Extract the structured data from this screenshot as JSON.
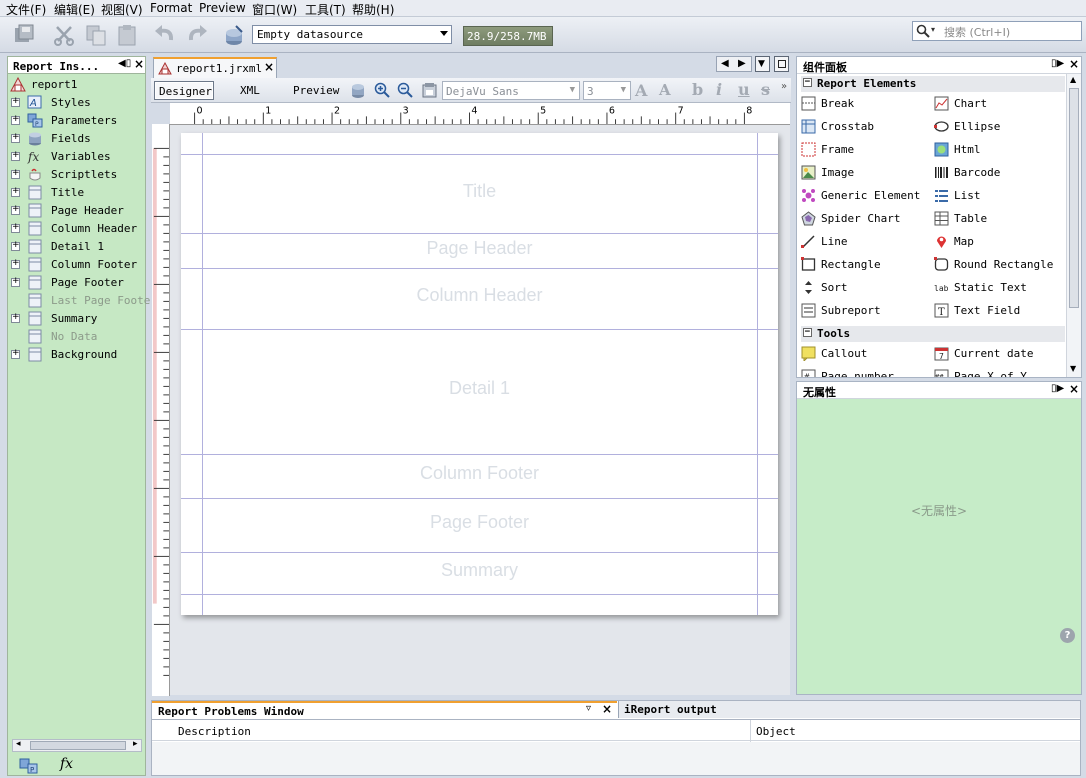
{
  "menu": [
    "文件(F)",
    "编辑(E)",
    "视图(V)",
    "Format",
    "Preview",
    "窗口(W)",
    "工具(T)",
    "帮助(H)"
  ],
  "toolbar": {
    "datasource": "Empty datasource",
    "memory": "28.9/258.7MB",
    "search_placeholder": "搜索 (Ctrl+I)"
  },
  "left_panel": {
    "title": "Report Ins...",
    "items": [
      {
        "label": "report1",
        "icon": "report-icon",
        "root": true
      },
      {
        "label": "Styles",
        "icon": "styles-icon"
      },
      {
        "label": "Parameters",
        "icon": "parameters-icon"
      },
      {
        "label": "Fields",
        "icon": "fields-icon"
      },
      {
        "label": "Variables",
        "icon": "variables-icon"
      },
      {
        "label": "Scriptlets",
        "icon": "scriptlets-icon"
      },
      {
        "label": "Title",
        "icon": "band-icon"
      },
      {
        "label": "Page Header",
        "icon": "band-icon"
      },
      {
        "label": "Column Header",
        "icon": "band-icon"
      },
      {
        "label": "Detail 1",
        "icon": "band-icon"
      },
      {
        "label": "Column Footer",
        "icon": "band-icon"
      },
      {
        "label": "Page Footer",
        "icon": "band-icon"
      },
      {
        "label": "Last Page Footer",
        "icon": "band-icon",
        "disabled": true
      },
      {
        "label": "Summary",
        "icon": "band-icon"
      },
      {
        "label": "No Data",
        "icon": "band-icon",
        "disabled": true
      },
      {
        "label": "Background",
        "icon": "band-icon"
      }
    ]
  },
  "editor": {
    "tab_label": "report1.jrxml",
    "modes": [
      "Designer",
      "XML",
      "Preview"
    ],
    "font_name": "DejaVu Sans",
    "font_size": "3",
    "ruler_numbers": [
      "0",
      "1",
      "2",
      "3",
      "4",
      "5",
      "6",
      "7",
      "8"
    ],
    "bands": [
      "Title",
      "Page Header",
      "Column Header",
      "Detail 1",
      "Column Footer",
      "Page Footer",
      "Summary"
    ]
  },
  "problems": {
    "title": "Report Problems Window",
    "output_tab": "iReport output",
    "columns": [
      "Description",
      "Object"
    ]
  },
  "palette": {
    "title": "组件面板",
    "sections": [
      {
        "title": "Report Elements",
        "items": [
          {
            "label": "Break",
            "icon": "break-icon"
          },
          {
            "label": "Chart",
            "icon": "chart-icon"
          },
          {
            "label": "Crosstab",
            "icon": "crosstab-icon"
          },
          {
            "label": "Ellipse",
            "icon": "ellipse-icon"
          },
          {
            "label": "Frame",
            "icon": "frame-icon"
          },
          {
            "label": "Html",
            "icon": "html-icon"
          },
          {
            "label": "Image",
            "icon": "image-icon"
          },
          {
            "label": "Barcode",
            "icon": "barcode-icon"
          },
          {
            "label": "Generic Element",
            "icon": "generic-element-icon"
          },
          {
            "label": "List",
            "icon": "list-icon"
          },
          {
            "label": "Spider Chart",
            "icon": "spider-chart-icon"
          },
          {
            "label": "Table",
            "icon": "table-icon"
          },
          {
            "label": "Line",
            "icon": "line-icon"
          },
          {
            "label": "Map",
            "icon": "map-icon"
          },
          {
            "label": "Rectangle",
            "icon": "rectangle-icon"
          },
          {
            "label": "Round Rectangle",
            "icon": "round-rectangle-icon"
          },
          {
            "label": "Sort",
            "icon": "sort-icon"
          },
          {
            "label": "Static Text",
            "icon": "static-text-icon"
          },
          {
            "label": "Subreport",
            "icon": "subreport-icon"
          },
          {
            "label": "Text Field",
            "icon": "text-field-icon"
          }
        ]
      },
      {
        "title": "Tools",
        "items": [
          {
            "label": "Callout",
            "icon": "callout-icon"
          },
          {
            "label": "Current date",
            "icon": "current-date-icon"
          },
          {
            "label": "Page number",
            "icon": "page-number-icon"
          },
          {
            "label": "Page X of Y",
            "icon": "page-x-of-y-icon"
          }
        ]
      }
    ]
  },
  "properties": {
    "title": "无属性",
    "empty_text": "<无属性>"
  },
  "colors": {
    "panel_green": "#c6e8c4",
    "band_line": "#b1b0dd",
    "tab_accent": "#f0a030"
  }
}
